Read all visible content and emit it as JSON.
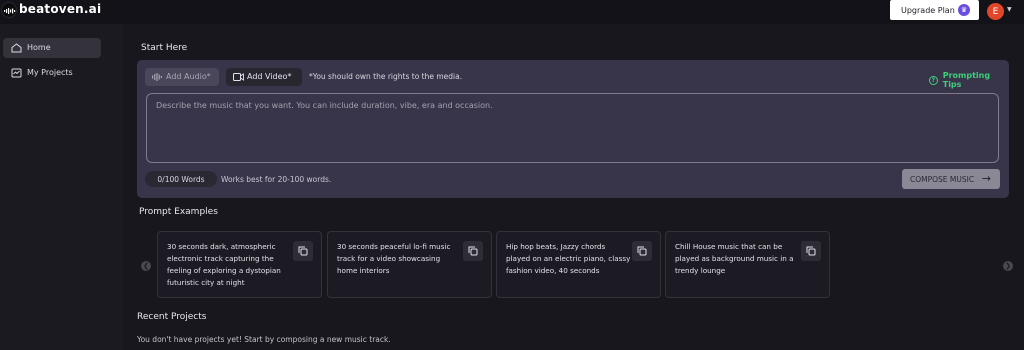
{
  "brand": {
    "name": "beatoven.ai"
  },
  "header": {
    "upgrade_label": "Upgrade Plan",
    "avatar_initial": "E"
  },
  "sidebar": {
    "items": [
      {
        "label": "Home"
      },
      {
        "label": "My Projects"
      }
    ]
  },
  "compose": {
    "title": "Start Here",
    "add_audio_label": "Add Audio*",
    "add_video_label": "Add Video*",
    "rights_note": "*You should own the rights to the media.",
    "tips_label": "Prompting Tips",
    "prompt_placeholder": "Describe the music that you want. You can include duration, vibe, era and occasion.",
    "word_count": "0/100 Words",
    "word_hint": "Works best for 20-100 words.",
    "compose_label": "COMPOSE MUSIC"
  },
  "examples": {
    "title": "Prompt Examples",
    "items": [
      {
        "text": "30 seconds dark, atmospheric electronic track capturing the feeling of exploring a dystopian futuristic city at night"
      },
      {
        "text": "30 seconds peaceful lo-fi music track for a video showcasing home interiors"
      },
      {
        "text": "Hip hop beats, Jazzy chords played on an electric piano, classy fashion video, 40 seconds"
      },
      {
        "text": "Chill House music that can be played as background music in a trendy lounge"
      }
    ]
  },
  "recent": {
    "title": "Recent Projects",
    "empty_text": "You don't have projects yet! Start by composing a new music track."
  },
  "colors": {
    "accent_green": "#3ecf7a",
    "avatar": "#e2462a",
    "panel": "#38354a"
  }
}
